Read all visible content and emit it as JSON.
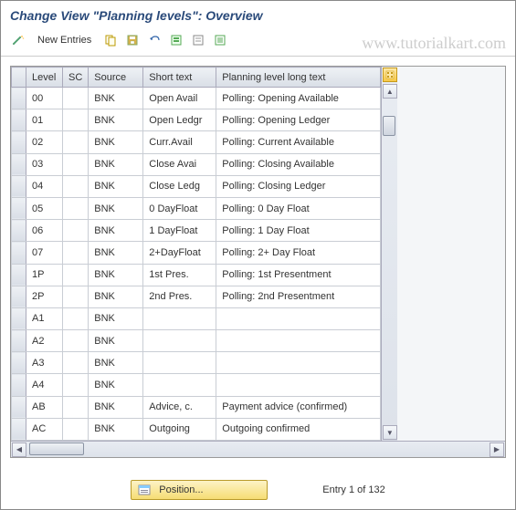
{
  "title": "Change View \"Planning levels\": Overview",
  "watermark": "www.tutorialkart.com",
  "toolbar": {
    "new_entries_label": "New Entries"
  },
  "columns": {
    "level": "Level",
    "sc": "SC",
    "source": "Source",
    "short": "Short text",
    "long": "Planning level long text"
  },
  "rows": [
    {
      "level": "00",
      "sc": "",
      "source": "BNK",
      "short": "Open Avail",
      "long": "Polling: Opening Available"
    },
    {
      "level": "01",
      "sc": "",
      "source": "BNK",
      "short": "Open Ledgr",
      "long": "Polling: Opening Ledger"
    },
    {
      "level": "02",
      "sc": "",
      "source": "BNK",
      "short": "Curr.Avail",
      "long": "Polling: Current Available"
    },
    {
      "level": "03",
      "sc": "",
      "source": "BNK",
      "short": "Close Avai",
      "long": "Polling: Closing Available"
    },
    {
      "level": "04",
      "sc": "",
      "source": "BNK",
      "short": "Close Ledg",
      "long": "Polling: Closing Ledger"
    },
    {
      "level": "05",
      "sc": "",
      "source": "BNK",
      "short": "0 DayFloat",
      "long": "Polling: 0 Day Float"
    },
    {
      "level": "06",
      "sc": "",
      "source": "BNK",
      "short": "1 DayFloat",
      "long": "Polling: 1 Day Float"
    },
    {
      "level": "07",
      "sc": "",
      "source": "BNK",
      "short": "2+DayFloat",
      "long": "Polling: 2+ Day Float"
    },
    {
      "level": "1P",
      "sc": "",
      "source": "BNK",
      "short": "1st Pres.",
      "long": "Polling: 1st Presentment"
    },
    {
      "level": "2P",
      "sc": "",
      "source": "BNK",
      "short": "2nd Pres.",
      "long": "Polling: 2nd Presentment"
    },
    {
      "level": "A1",
      "sc": "",
      "source": "BNK",
      "short": "",
      "long": ""
    },
    {
      "level": "A2",
      "sc": "",
      "source": "BNK",
      "short": "",
      "long": ""
    },
    {
      "level": "A3",
      "sc": "",
      "source": "BNK",
      "short": "",
      "long": ""
    },
    {
      "level": "A4",
      "sc": "",
      "source": "BNK",
      "short": "",
      "long": ""
    },
    {
      "level": "AB",
      "sc": "",
      "source": "BNK",
      "short": "Advice, c.",
      "long": "Payment advice (confirmed)"
    },
    {
      "level": "AC",
      "sc": "",
      "source": "BNK",
      "short": "Outgoing",
      "long": "Outgoing confirmed"
    }
  ],
  "footer": {
    "position_label": "Position...",
    "entry_text": "Entry 1 of 132"
  }
}
